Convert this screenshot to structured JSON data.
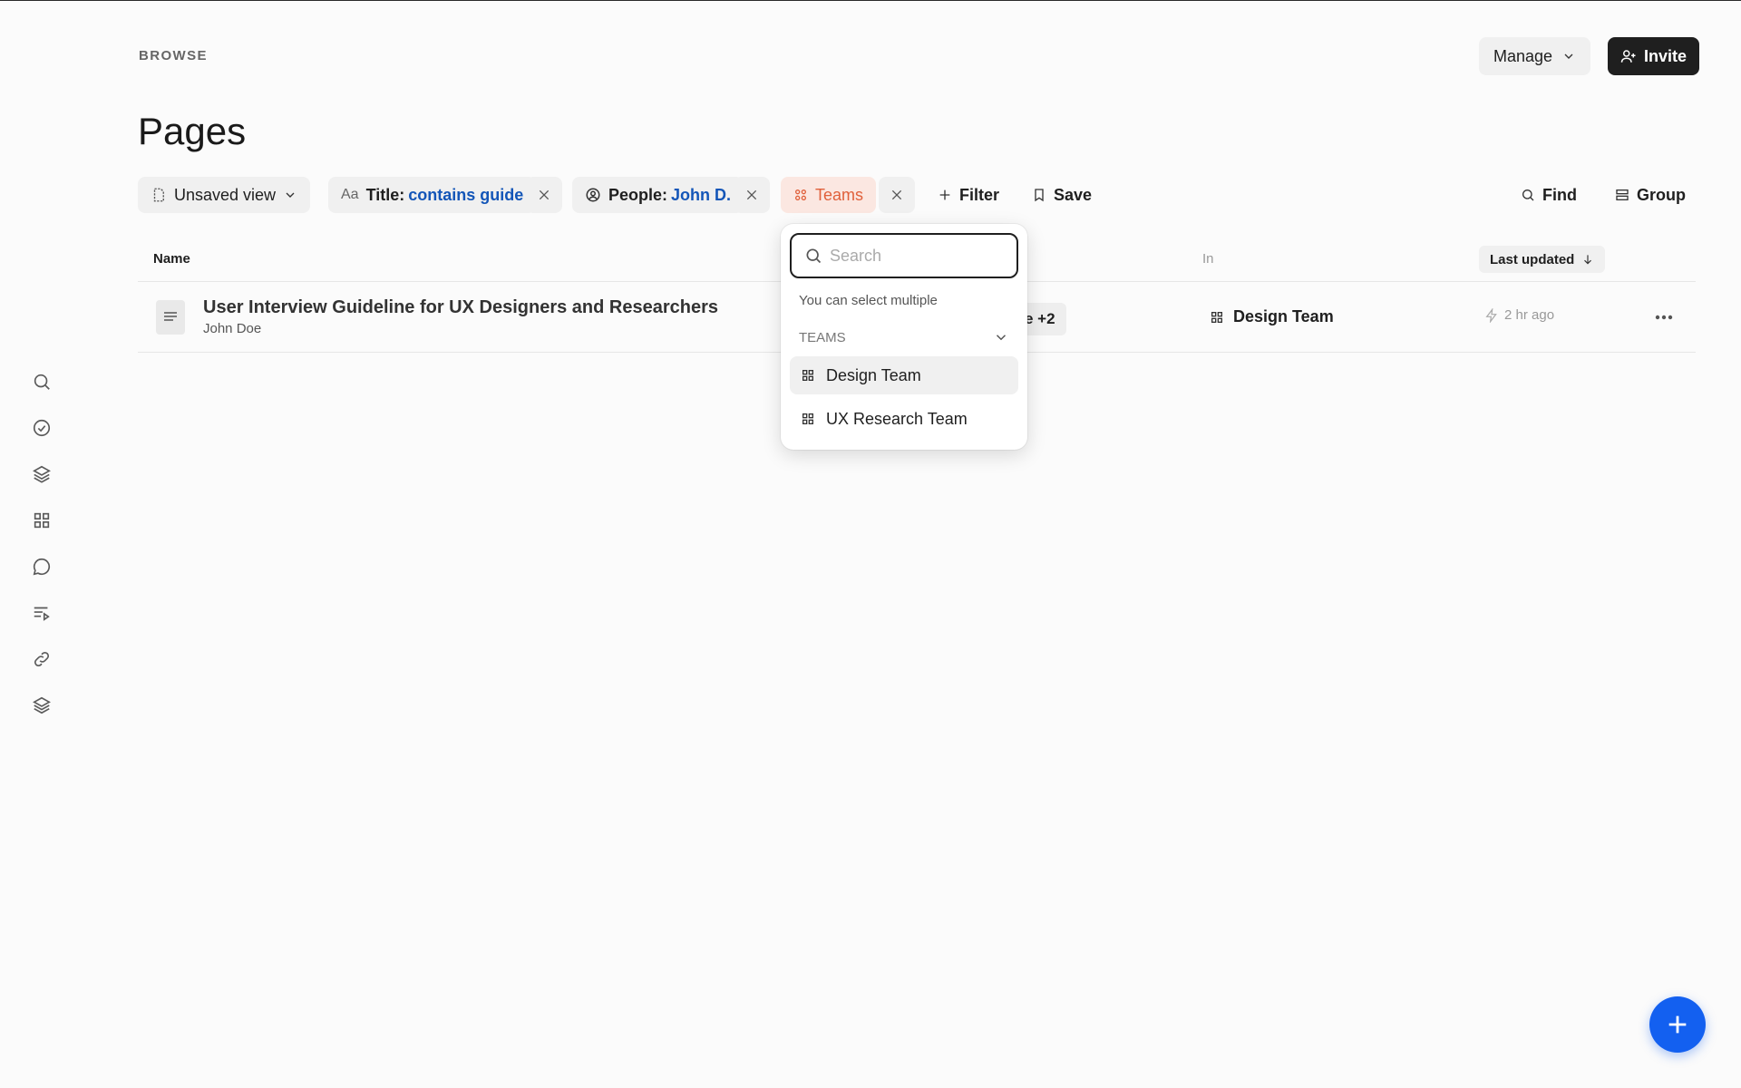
{
  "header": {
    "section": "BROWSE",
    "title": "Pages",
    "manage_label": "Manage",
    "invite_label": "Invite"
  },
  "sidebar": {
    "icons": [
      "search-icon",
      "check-circle-icon",
      "layers-icon",
      "grid-icon",
      "chat-bubble-icon",
      "list-play-icon",
      "link-icon",
      "stack-icon"
    ]
  },
  "filters": {
    "view_label": "Unsaved view",
    "title_key": "Title:",
    "title_value": "contains guide",
    "title_prefix_icon": "Aa",
    "people_key": "People:",
    "people_value": "John D.",
    "teams_label": "Teams",
    "filter_label": "Filter",
    "save_label": "Save",
    "find_label": "Find",
    "group_label": "Group"
  },
  "table": {
    "col_name": "Name",
    "col_in": "In",
    "col_updated": "Last updated",
    "rows": [
      {
        "title": "User Interview Guideline for UX Designers and Researchers",
        "author": "John Doe",
        "people_peek": "e +2",
        "in": "Design Team",
        "updated": "2 hr ago"
      }
    ]
  },
  "dropdown": {
    "search_placeholder": "Search",
    "hint": "You can select multiple",
    "section": "TEAMS",
    "items": [
      "Design Team",
      "UX Research Team"
    ]
  },
  "colors": {
    "accent_blue": "#1360f0",
    "link_blue": "#1456b8",
    "teams_orange": "#e0603b"
  }
}
